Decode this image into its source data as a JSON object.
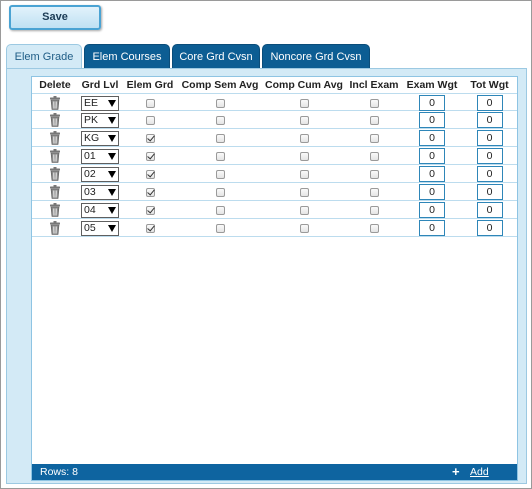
{
  "toolbar": {
    "save_label": "Save"
  },
  "tabs": [
    {
      "label": "Elem Grade",
      "active": true
    },
    {
      "label": "Elem Courses",
      "active": false
    },
    {
      "label": "Core Grd Cvsn",
      "active": false
    },
    {
      "label": "Noncore Grd Cvsn",
      "active": false
    }
  ],
  "grid": {
    "columns": [
      "Delete",
      "Grd Lvl",
      "Elem Grd",
      "Comp Sem Avg",
      "Comp Cum Avg",
      "Incl Exam",
      "Exam Wgt",
      "Tot Wgt"
    ],
    "rows": [
      {
        "grd_lvl": "EE",
        "elem_grd": false,
        "comp_sem_avg": false,
        "comp_cum_avg": false,
        "incl_exam": false,
        "exam_wgt": "0",
        "tot_wgt": "0"
      },
      {
        "grd_lvl": "PK",
        "elem_grd": false,
        "comp_sem_avg": false,
        "comp_cum_avg": false,
        "incl_exam": false,
        "exam_wgt": "0",
        "tot_wgt": "0"
      },
      {
        "grd_lvl": "KG",
        "elem_grd": true,
        "comp_sem_avg": false,
        "comp_cum_avg": false,
        "incl_exam": false,
        "exam_wgt": "0",
        "tot_wgt": "0"
      },
      {
        "grd_lvl": "01",
        "elem_grd": true,
        "comp_sem_avg": false,
        "comp_cum_avg": false,
        "incl_exam": false,
        "exam_wgt": "0",
        "tot_wgt": "0"
      },
      {
        "grd_lvl": "02",
        "elem_grd": true,
        "comp_sem_avg": false,
        "comp_cum_avg": false,
        "incl_exam": false,
        "exam_wgt": "0",
        "tot_wgt": "0"
      },
      {
        "grd_lvl": "03",
        "elem_grd": true,
        "comp_sem_avg": false,
        "comp_cum_avg": false,
        "incl_exam": false,
        "exam_wgt": "0",
        "tot_wgt": "0"
      },
      {
        "grd_lvl": "04",
        "elem_grd": true,
        "comp_sem_avg": false,
        "comp_cum_avg": false,
        "incl_exam": false,
        "exam_wgt": "0",
        "tot_wgt": "0"
      },
      {
        "grd_lvl": "05",
        "elem_grd": true,
        "comp_sem_avg": false,
        "comp_cum_avg": false,
        "incl_exam": false,
        "exam_wgt": "0",
        "tot_wgt": "0"
      }
    ],
    "footer": {
      "rows_label": "Rows: 8",
      "add_icon": "+",
      "add_label": "Add"
    }
  },
  "icons": {
    "delete": "trash-icon",
    "dropdown": "dropdown-arrow-icon"
  },
  "colors": {
    "accent": "#0e64a0",
    "tab_active_bg": "#d3eaf6",
    "border": "#8ec4e3"
  }
}
